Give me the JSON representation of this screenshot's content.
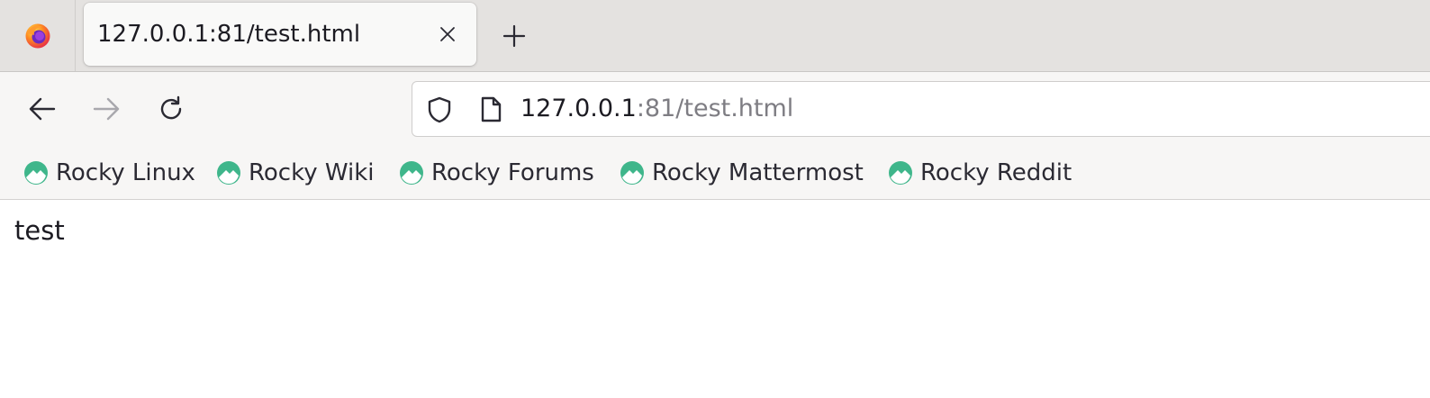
{
  "colors": {
    "tabstrip_bg": "#e4e2e0",
    "toolbar_bg": "#f7f6f5",
    "bookmark_icon": "#3fb68b",
    "url_muted": "#7e7d83"
  },
  "tab": {
    "title": "127.0.0.1:81/test.html",
    "icons": {
      "browser_logo": "firefox-logo",
      "close": "close-icon",
      "new_tab": "plus-icon"
    }
  },
  "navbar": {
    "icons": [
      "back-arrow-icon",
      "forward-arrow-icon",
      "reload-icon"
    ],
    "url": {
      "host": "127.0.0.1",
      "rest": ":81/test.html",
      "icons": [
        "shield-icon",
        "page-icon"
      ]
    }
  },
  "bookmarks": [
    {
      "label": "Rocky Linux",
      "icon": "rocky-logo-icon"
    },
    {
      "label": "Rocky Wiki",
      "icon": "rocky-logo-icon"
    },
    {
      "label": "Rocky Forums",
      "icon": "rocky-logo-icon"
    },
    {
      "label": "Rocky Mattermost",
      "icon": "rocky-logo-icon"
    },
    {
      "label": "Rocky Reddit",
      "icon": "rocky-logo-icon"
    }
  ],
  "page": {
    "body_text": "test"
  }
}
